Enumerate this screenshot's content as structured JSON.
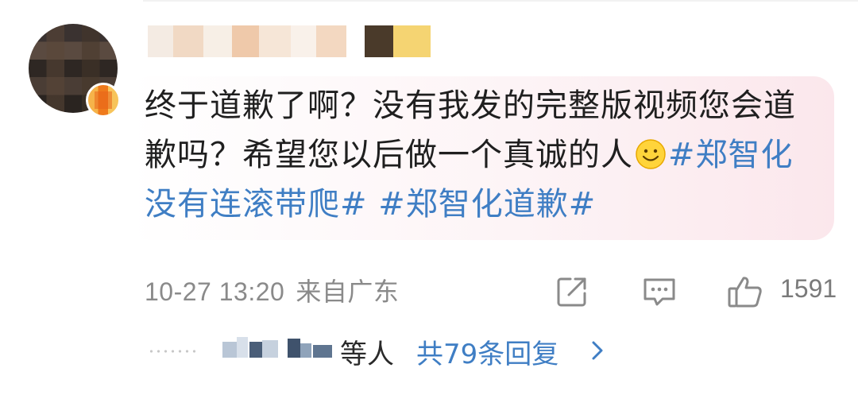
{
  "comment": {
    "text_before": "终于道歉了啊？没有我发的完整版视频您会道歉吗？希望您以后做一个真诚的人",
    "emoji": "smile-emoji",
    "hashtags": [
      "#郑智化 没有连滚带爬#",
      "#郑智化道歉#"
    ],
    "hashtag_separator": " "
  },
  "meta": {
    "datetime": "10-27 13:20",
    "location": "来自广东",
    "like_count": "1591"
  },
  "replies": {
    "prefix": "等人",
    "link": "共79条回复"
  },
  "icons": {
    "share": "share-icon",
    "comment": "comment-icon",
    "like": "thumbs-up-icon",
    "chevron": "chevron-right-icon"
  },
  "colors": {
    "hashtag": "#3f7ec4",
    "meta_text": "#8a8a8a",
    "bubble_tint": "#fbe7ec"
  }
}
